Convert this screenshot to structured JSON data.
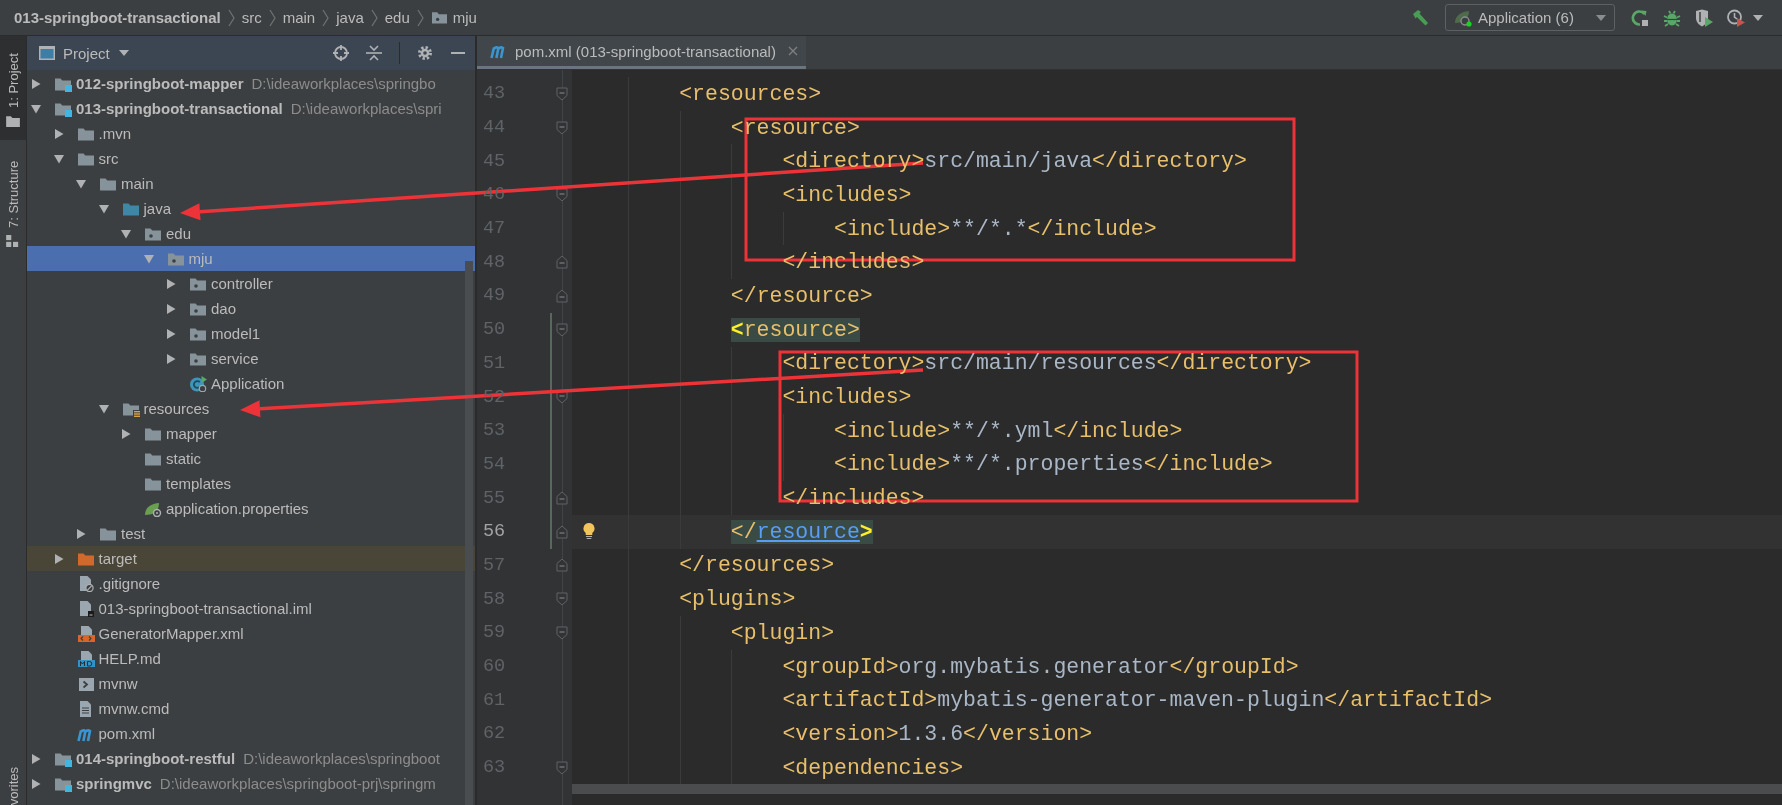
{
  "breadcrumbs": [
    {
      "label": "013-springboot-transactional",
      "kind": "module"
    },
    {
      "label": "src",
      "kind": "dir"
    },
    {
      "label": "main",
      "kind": "dir"
    },
    {
      "label": "java",
      "kind": "dir"
    },
    {
      "label": "edu",
      "kind": "dir"
    },
    {
      "label": "mju",
      "kind": "package"
    }
  ],
  "run_config": {
    "label": "Application (6)"
  },
  "tool_strip": [
    {
      "label": "1: Project",
      "kind": "project",
      "selected": true
    },
    {
      "label": "7: Structure",
      "kind": "structure",
      "selected": false
    },
    {
      "label": "vorites",
      "kind": "favorites",
      "selected": false
    }
  ],
  "project_panel": {
    "title": "Project",
    "tree": [
      {
        "label": "012-springboot-mapper",
        "path": "D:\\ideaworkplaces\\springbo",
        "kind": "module",
        "expanded": false,
        "selected": false
      },
      {
        "label": "013-springboot-transactional",
        "path": "D:\\ideaworkplaces\\spri",
        "kind": "module",
        "expanded": true,
        "selected": false,
        "children": [
          {
            "label": ".mvn",
            "kind": "folder",
            "expanded": false,
            "selected": false
          },
          {
            "label": "src",
            "kind": "folder",
            "expanded": true,
            "selected": false,
            "children": [
              {
                "label": "main",
                "kind": "folder",
                "expanded": true,
                "selected": false,
                "children": [
                  {
                    "label": "java",
                    "kind": "source-folder",
                    "expanded": true,
                    "selected": false,
                    "children": [
                      {
                        "label": "edu",
                        "kind": "package",
                        "expanded": true,
                        "selected": false,
                        "children": [
                          {
                            "label": "mju",
                            "kind": "package",
                            "expanded": true,
                            "selected": true,
                            "children": [
                              {
                                "label": "controller",
                                "kind": "package",
                                "expanded": false,
                                "selected": false
                              },
                              {
                                "label": "dao",
                                "kind": "package",
                                "expanded": false,
                                "selected": false
                              },
                              {
                                "label": "model1",
                                "kind": "package",
                                "expanded": false,
                                "selected": false
                              },
                              {
                                "label": "service",
                                "kind": "package",
                                "expanded": false,
                                "selected": false
                              },
                              {
                                "label": "Application",
                                "kind": "app-class",
                                "selected": false
                              }
                            ]
                          }
                        ]
                      }
                    ]
                  },
                  {
                    "label": "resources",
                    "kind": "resources-folder",
                    "expanded": true,
                    "selected": false,
                    "children": [
                      {
                        "label": "mapper",
                        "kind": "folder",
                        "expanded": false,
                        "selected": false
                      },
                      {
                        "label": "static",
                        "kind": "folder",
                        "selected": false
                      },
                      {
                        "label": "templates",
                        "kind": "folder",
                        "selected": false
                      },
                      {
                        "label": "application.properties",
                        "kind": "config-file",
                        "selected": false
                      }
                    ]
                  }
                ]
              },
              {
                "label": "test",
                "kind": "folder",
                "expanded": false,
                "selected": false
              }
            ]
          },
          {
            "label": "target",
            "kind": "excluded-folder",
            "expanded": false,
            "selected": false
          },
          {
            "label": ".gitignore",
            "kind": "ignore-file",
            "selected": false
          },
          {
            "label": "013-springboot-transactional.iml",
            "kind": "module-file",
            "selected": false
          },
          {
            "label": "GeneratorMapper.xml",
            "kind": "xml-file",
            "selected": false
          },
          {
            "label": "HELP.md",
            "kind": "markdown-file",
            "selected": false
          },
          {
            "label": "mvnw",
            "kind": "script-file",
            "selected": false
          },
          {
            "label": "mvnw.cmd",
            "kind": "text-file",
            "selected": false
          },
          {
            "label": "pom.xml",
            "kind": "maven-file",
            "selected": false
          }
        ]
      },
      {
        "label": "014-springboot-restful",
        "path": "D:\\ideaworkplaces\\springboot",
        "kind": "module",
        "expanded": false,
        "selected": false
      },
      {
        "label": "springmvc",
        "path": "D:\\ideaworkplaces\\springboot-prj\\springm",
        "kind": "module",
        "expanded": false,
        "selected": false
      }
    ]
  },
  "editor": {
    "tabs": [
      {
        "label": "pom.xml (013-springboot-transactional)",
        "selected": true
      }
    ],
    "lines": [
      {
        "number": "43",
        "text": "        <resources>",
        "kind": "opening",
        "current": false,
        "matched": false,
        "link": false,
        "changed": false,
        "bulb": false
      },
      {
        "number": "44",
        "text": "            <resource>",
        "kind": "opening",
        "current": false,
        "matched": false,
        "link": false,
        "changed": false,
        "bulb": false
      },
      {
        "number": "45",
        "text": "                <directory>src/main/java</directory>",
        "kind": "plain",
        "current": false,
        "matched": false,
        "link": false,
        "changed": false,
        "bulb": false
      },
      {
        "number": "46",
        "text": "                <includes>",
        "kind": "opening",
        "current": false,
        "matched": false,
        "link": false,
        "changed": false,
        "bulb": false
      },
      {
        "number": "47",
        "text": "                    <include>**/*.*</include>",
        "kind": "plain",
        "current": false,
        "matched": false,
        "link": false,
        "changed": false,
        "bulb": false
      },
      {
        "number": "48",
        "text": "                </includes>",
        "kind": "closing",
        "current": false,
        "matched": false,
        "link": false,
        "changed": false,
        "bulb": false
      },
      {
        "number": "49",
        "text": "            </resource>",
        "kind": "closing",
        "current": false,
        "matched": false,
        "link": false,
        "changed": false,
        "bulb": false
      },
      {
        "number": "50",
        "text": "            <resource>",
        "kind": "opening",
        "current": false,
        "matched": true,
        "link": false,
        "changed": true,
        "bulb": false
      },
      {
        "number": "51",
        "text": "                <directory>src/main/resources</directory>",
        "kind": "plain",
        "current": false,
        "matched": false,
        "link": false,
        "changed": true,
        "bulb": false
      },
      {
        "number": "52",
        "text": "                <includes>",
        "kind": "opening",
        "current": false,
        "matched": false,
        "link": false,
        "changed": true,
        "bulb": false
      },
      {
        "number": "53",
        "text": "                    <include>**/*.yml</include>",
        "kind": "plain",
        "current": false,
        "matched": false,
        "link": false,
        "changed": true,
        "bulb": false
      },
      {
        "number": "54",
        "text": "                    <include>**/*.properties</include>",
        "kind": "plain",
        "current": false,
        "matched": false,
        "link": false,
        "changed": true,
        "bulb": false
      },
      {
        "number": "55",
        "text": "                </includes>",
        "kind": "closing",
        "current": false,
        "matched": false,
        "link": false,
        "changed": true,
        "bulb": false
      },
      {
        "number": "56",
        "text": "            </resource>",
        "kind": "closing",
        "current": true,
        "matched": true,
        "link": true,
        "changed": true,
        "bulb": true
      },
      {
        "number": "57",
        "text": "        </resources>",
        "kind": "closing",
        "current": false,
        "matched": false,
        "link": false,
        "changed": false,
        "bulb": false
      },
      {
        "number": "58",
        "text": "        <plugins>",
        "kind": "opening",
        "current": false,
        "matched": false,
        "link": false,
        "changed": false,
        "bulb": false
      },
      {
        "number": "59",
        "text": "            <plugin>",
        "kind": "opening",
        "current": false,
        "matched": false,
        "link": false,
        "changed": false,
        "bulb": false
      },
      {
        "number": "60",
        "text": "                <groupId>org.mybatis.generator</groupId>",
        "kind": "plain",
        "current": false,
        "matched": false,
        "link": false,
        "changed": false,
        "bulb": false
      },
      {
        "number": "61",
        "text": "                <artifactId>mybatis-generator-maven-plugin</artifactId>",
        "kind": "plain",
        "current": false,
        "matched": false,
        "link": false,
        "changed": false,
        "bulb": false
      },
      {
        "number": "62",
        "text": "                <version>1.3.6</version>",
        "kind": "plain",
        "current": false,
        "matched": false,
        "link": false,
        "changed": false,
        "bulb": false
      },
      {
        "number": "63",
        "text": "                <dependencies>",
        "kind": "opening",
        "current": false,
        "matched": false,
        "link": false,
        "changed": false,
        "bulb": false
      }
    ]
  }
}
